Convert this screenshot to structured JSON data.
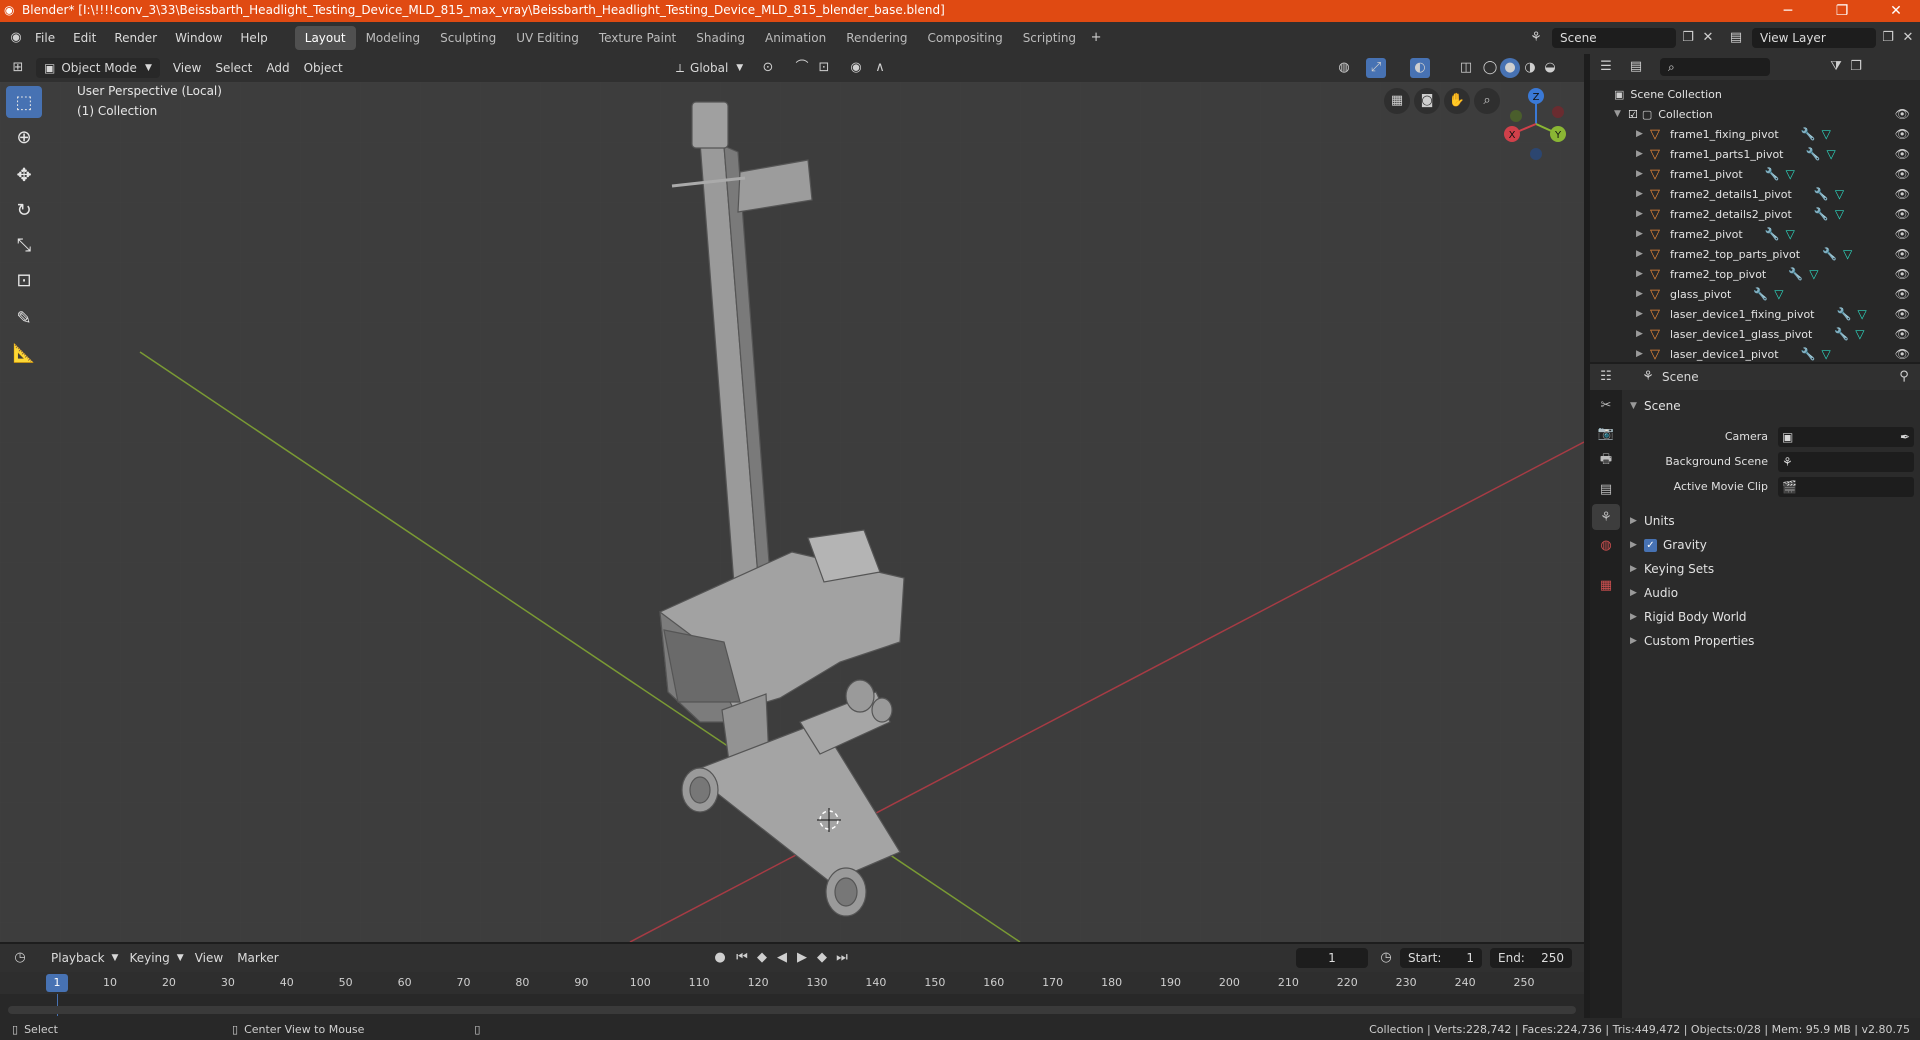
{
  "titlebar": {
    "title": "Blender* [I:\\!!!!conv_3\\33\\Beissbarth_Headlight_Testing_Device_MLD_815_max_vray\\Beissbarth_Headlight_Testing_Device_MLD_815_blender_base.blend]",
    "minimize": "─",
    "maximize": "❐",
    "close": "✕"
  },
  "menus": [
    "File",
    "Edit",
    "Render",
    "Window",
    "Help"
  ],
  "workspaces": [
    "Layout",
    "Modeling",
    "Sculpting",
    "UV Editing",
    "Texture Paint",
    "Shading",
    "Animation",
    "Rendering",
    "Compositing",
    "Scripting"
  ],
  "active_workspace": "Layout",
  "scene_field": "Scene",
  "view_layer_field": "View Layer",
  "viewport_header": {
    "mode": "Object Mode",
    "menus": [
      "View",
      "Select",
      "Add",
      "Object"
    ],
    "transform": "Global"
  },
  "viewport": {
    "perspective": "User Perspective (Local)",
    "collection": "(1) Collection",
    "gizmo": {
      "z": "Z",
      "y": "Y",
      "x": "X"
    }
  },
  "outliner": {
    "root": "Scene Collection",
    "collection": "Collection",
    "items": [
      "frame1_fixing_pivot",
      "frame1_parts1_pivot",
      "frame1_pivot",
      "frame2_details1_pivot",
      "frame2_details2_pivot",
      "frame2_pivot",
      "frame2_top_parts_pivot",
      "frame2_top_pivot",
      "glass_pivot",
      "laser_device1_fixing_pivot",
      "laser_device1_glass_pivot",
      "laser_device1_pivot"
    ]
  },
  "properties": {
    "context": "Scene",
    "section": "Scene",
    "fields": [
      {
        "label": "Camera"
      },
      {
        "label": "Background Scene"
      },
      {
        "label": "Active Movie Clip"
      }
    ],
    "panels": [
      "Units",
      "Gravity",
      "Keying Sets",
      "Audio",
      "Rigid Body World",
      "Custom Properties"
    ]
  },
  "timeline": {
    "menus": [
      "Playback",
      "Keying",
      "View",
      "Marker"
    ],
    "current_frame": "1",
    "start_label": "Start:",
    "start": "1",
    "end_label": "End:",
    "end": "250",
    "ticks": [
      "1",
      "10",
      "20",
      "30",
      "40",
      "50",
      "60",
      "70",
      "80",
      "90",
      "100",
      "110",
      "120",
      "130",
      "140",
      "150",
      "160",
      "170",
      "180",
      "190",
      "200",
      "210",
      "220",
      "230",
      "240",
      "250"
    ]
  },
  "statusbar": {
    "left": "Select",
    "middle": "Center View to Mouse",
    "right": "Collection | Verts:228,742 | Faces:224,736 | Tris:449,472 | Objects:0/28 | Mem: 95.9 MB | v2.80.75"
  }
}
